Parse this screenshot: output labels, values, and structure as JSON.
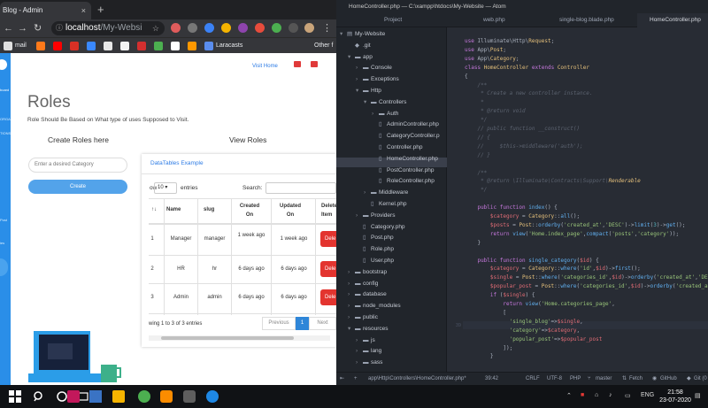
{
  "browser": {
    "tab_title": "Blog - Admin",
    "tab_close": "×",
    "new_tab": "+",
    "url_host": "localhost",
    "url_path": "/My-Websi",
    "bookmarks": [
      {
        "label": "mail",
        "color": "#e0e0e0"
      },
      {
        "label": "",
        "color": "#ff7a1a"
      },
      {
        "label": "",
        "color": "#ff0000"
      },
      {
        "label": "",
        "color": "#d93025"
      },
      {
        "label": "",
        "color": "#3a88fe"
      },
      {
        "label": "",
        "color": "#e8e8e8"
      },
      {
        "label": "",
        "color": "#f3f3f3"
      },
      {
        "label": "",
        "color": "#d32f2f"
      },
      {
        "label": "",
        "color": "#4caf50"
      },
      {
        "label": "",
        "color": "#ffffff"
      },
      {
        "label": "",
        "color": "#ff9800"
      },
      {
        "label": "Laracasts",
        "color": "#5a8dee"
      }
    ],
    "bookmarks_other": "Other f"
  },
  "app": {
    "sidebar_items": [
      "board",
      "ORGANIZATION",
      "TIONS",
      "Post",
      "ies"
    ],
    "visit_home": "Visit Home",
    "title": "Roles",
    "description": "Role Should Be Based on What type of uses Supposed to Visit.",
    "create_heading": "Create Roles here",
    "view_heading": "View Roles",
    "input_placeholder": "Enter a desired Category",
    "create_button": "Create"
  },
  "datatable": {
    "title": "DataTables Example",
    "length_value": "10",
    "length_before": "ow",
    "length_after": "entries",
    "search_label": "Search:",
    "columns": [
      "Name",
      "slug",
      "Created On",
      "Updated On",
      "Delete Item"
    ],
    "rows": [
      {
        "id": "1",
        "name": "Manager",
        "slug": "manager",
        "created": "1 week ago",
        "updated": "1 week ago",
        "action": "Dele"
      },
      {
        "id": "2",
        "name": "HR",
        "slug": "hr",
        "created": "6 days ago",
        "updated": "6 days ago",
        "action": "Dele"
      },
      {
        "id": "3",
        "name": "Admin",
        "slug": "admin",
        "created": "6 days ago",
        "updated": "6 days ago",
        "action": "Dele"
      }
    ],
    "info": "wing 1 to 3 of 3 entries",
    "previous": "Previous",
    "page": "1",
    "next": "Next"
  },
  "atom": {
    "window_title": "HomeController.php — C:\\xampp\\htdocs\\My-Website — Atom",
    "tabs": [
      "Project",
      "web.php",
      "single-blog.blade.php",
      "HomeController.php"
    ],
    "tree": [
      {
        "label": "My-Website",
        "depth": 0,
        "arrow": "▾",
        "icon": "▤"
      },
      {
        "label": ".git",
        "depth": 1,
        "arrow": "",
        "icon": "◆"
      },
      {
        "label": "app",
        "depth": 1,
        "arrow": "▾",
        "icon": "▬"
      },
      {
        "label": "Console",
        "depth": 2,
        "arrow": "›",
        "icon": "▬"
      },
      {
        "label": "Exceptions",
        "depth": 2,
        "arrow": "›",
        "icon": "▬"
      },
      {
        "label": "Http",
        "depth": 2,
        "arrow": "▾",
        "icon": "▬"
      },
      {
        "label": "Controllers",
        "depth": 3,
        "arrow": "▾",
        "icon": "▬"
      },
      {
        "label": "Auth",
        "depth": 4,
        "arrow": "›",
        "icon": "▬"
      },
      {
        "label": "AdminController.php",
        "depth": 4,
        "arrow": "",
        "icon": "▯"
      },
      {
        "label": "CategoryController.p",
        "depth": 4,
        "arrow": "",
        "icon": "▯"
      },
      {
        "label": "Controller.php",
        "depth": 4,
        "arrow": "",
        "icon": "▯"
      },
      {
        "label": "HomeController.php",
        "depth": 4,
        "arrow": "",
        "icon": "▯"
      },
      {
        "label": "PostController.php",
        "depth": 4,
        "arrow": "",
        "icon": "▯"
      },
      {
        "label": "RoleController.php",
        "depth": 4,
        "arrow": "",
        "icon": "▯"
      },
      {
        "label": "Middleware",
        "depth": 3,
        "arrow": "›",
        "icon": "▬"
      },
      {
        "label": "Kernel.php",
        "depth": 3,
        "arrow": "",
        "icon": "▯"
      },
      {
        "label": "Providers",
        "depth": 2,
        "arrow": "›",
        "icon": "▬"
      },
      {
        "label": "Category.php",
        "depth": 2,
        "arrow": "",
        "icon": "▯"
      },
      {
        "label": "Post.php",
        "depth": 2,
        "arrow": "",
        "icon": "▯"
      },
      {
        "label": "Role.php",
        "depth": 2,
        "arrow": "",
        "icon": "▯"
      },
      {
        "label": "User.php",
        "depth": 2,
        "arrow": "",
        "icon": "▯"
      },
      {
        "label": "bootstrap",
        "depth": 1,
        "arrow": "›",
        "icon": "▬"
      },
      {
        "label": "config",
        "depth": 1,
        "arrow": "›",
        "icon": "▬"
      },
      {
        "label": "database",
        "depth": 1,
        "arrow": "›",
        "icon": "▬"
      },
      {
        "label": "node_modules",
        "depth": 1,
        "arrow": "›",
        "icon": "▬"
      },
      {
        "label": "public",
        "depth": 1,
        "arrow": "›",
        "icon": "▬"
      },
      {
        "label": "resources",
        "depth": 1,
        "arrow": "▾",
        "icon": "▬"
      },
      {
        "label": "js",
        "depth": 2,
        "arrow": "›",
        "icon": "▬"
      },
      {
        "label": "lang",
        "depth": 2,
        "arrow": "›",
        "icon": "▬"
      },
      {
        "label": "sass",
        "depth": 2,
        "arrow": "›",
        "icon": "▬"
      }
    ],
    "line_numbers": [
      "",
      "",
      "",
      "",
      "",
      "",
      "",
      "",
      "",
      "",
      "",
      "",
      "",
      "",
      "",
      "",
      "",
      "",
      "",
      "",
      "",
      "",
      "",
      "",
      "",
      "",
      "",
      "",
      "",
      "",
      "",
      "",
      "",
      "",
      "",
      "",
      "39",
      "",
      "",
      "",
      "",
      "",
      ""
    ],
    "code_lines": [
      {
        "html": "<span class='kw'>use</span> Illuminate\\Http\\<span class='cls'>Request</span>;"
      },
      {
        "html": "<span class='kw'>use</span> App\\<span class='cls'>Post</span>;"
      },
      {
        "html": "<span class='kw'>use</span> App\\<span class='cls'>Category</span>;"
      },
      {
        "html": "<span class='kw'>class</span> <span class='cls'>HomeController</span> <span class='kw'>extends</span> <span class='cls'>Controller</span>"
      },
      {
        "html": "{"
      },
      {
        "html": "    <span class='cm'>/**</span>"
      },
      {
        "html": "    <span class='cm'> * Create a new controller instance.</span>"
      },
      {
        "html": "    <span class='cm'> *</span>"
      },
      {
        "html": "    <span class='cm'> * @return void</span>"
      },
      {
        "html": "    <span class='cm'> */</span>"
      },
      {
        "html": "    <span class='cm'>// public function __construct()</span>"
      },
      {
        "html": "    <span class='cm'>// {</span>"
      },
      {
        "html": "    <span class='cm'>//     $this->middleware('auth');</span>"
      },
      {
        "html": "    <span class='cm'>// }</span>"
      },
      {
        "html": ""
      },
      {
        "html": "    <span class='cm'>/**</span>"
      },
      {
        "html": "    <span class='cm'> * @return \\Illuminate\\Contracts\\Support\\<span class='cls'>Renderable</span></span>"
      },
      {
        "html": "    <span class='cm'> */</span>"
      },
      {
        "html": ""
      },
      {
        "html": "    <span class='kw'>public function</span> <span class='fn'>index</span>() {"
      },
      {
        "html": "        <span class='var'>$category</span> = <span class='cls'>Category</span>::<span class='fn'>all</span>();"
      },
      {
        "html": "        <span class='var'>$posts</span> = <span class='cls'>Post</span>::<span class='fn'>orderby</span>(<span class='str'>'created_at'</span>,<span class='str'>'DESC'</span>)-><span class='fn'>limit</span>(<span class='op'>3</span>)-><span class='fn'>get</span>();"
      },
      {
        "html": "        <span class='kw'>return</span> <span class='fn'>view</span>(<span class='str'>'Home.index_page'</span>,<span class='fn'>compact</span>(<span class='str'>'posts'</span>,<span class='str'>'category'</span>));"
      },
      {
        "html": "    }"
      },
      {
        "html": ""
      },
      {
        "html": "    <span class='kw'>public function</span> <span class='fn'>single_category</span>(<span class='var'>$id</span>) {"
      },
      {
        "html": "        <span class='var'>$category</span> = <span class='cls'>Category</span>::<span class='fn'>where</span>(<span class='str'>'id'</span>,<span class='var'>$id</span>)-><span class='fn'>first</span>();"
      },
      {
        "html": "        <span class='var'>$single</span> = <span class='cls'>Post</span>::<span class='fn'>where</span>(<span class='str'>'categories_id'</span>,<span class='var'>$id</span>)-><span class='fn'>orderby</span>(<span class='str'>'created_at'</span>,<span class='str'>'DESC'</span>)"
      },
      {
        "html": "        <span class='var'>$popular_post</span> = <span class='cls'>Post</span>::<span class='fn'>where</span>(<span class='str'>'categories_id'</span>,<span class='var'>$id</span>)-><span class='fn'>orderby</span>(<span class='str'>'created_at'</span>,"
      },
      {
        "html": "        <span class='kw'>if</span> (<span class='var'>$single</span>) {"
      },
      {
        "html": "            <span class='kw'>return</span> <span class='fn'>view</span>(<span class='str'>'Home.categories_page'</span>,"
      },
      {
        "html": "            ["
      },
      {
        "html": "              <span class='str'>'single_blog'</span>=><span class='var'>$single</span>,"
      },
      {
        "html": "              <span class='str'>'category'</span>=><span class='var'>$category</span>,"
      },
      {
        "html": "              <span class='str'>'popular_post'</span>=><span class='var'>$popular_post</span>"
      },
      {
        "html": "            ]);"
      },
      {
        "html": "        }"
      }
    ],
    "status": {
      "path": "app\\Http\\Controllers\\HomeController.php*",
      "cursor": "39:42",
      "eol": "CRLF",
      "encoding": "UTF-8",
      "grammar": "PHP",
      "branch": "master",
      "fetch": "Fetch",
      "github": "GitHub",
      "git": "Git (0"
    }
  },
  "taskbar": {
    "lang": "ENG",
    "time": "21:58",
    "date": "23-07-2020"
  }
}
